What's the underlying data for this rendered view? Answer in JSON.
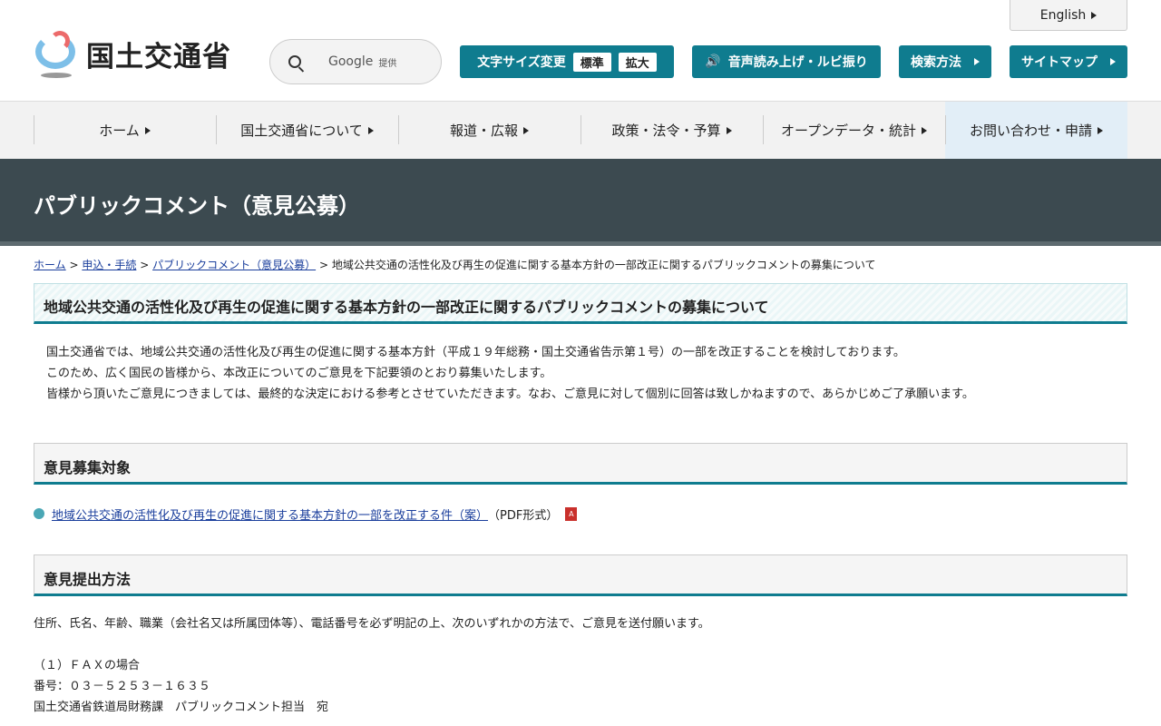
{
  "header": {
    "logo_text": "国土交通省",
    "search_brand": "Google",
    "search_suffix": "提供",
    "english": "English",
    "font_size_label": "文字サイズ変更",
    "font_standard": "標準",
    "font_large": "拡大",
    "speech": "音声読み上げ・ルビ振り",
    "search_method": "検索方法",
    "sitemap": "サイトマップ"
  },
  "nav": [
    {
      "label": "ホーム"
    },
    {
      "label": "国土交通省について"
    },
    {
      "label": "報道・広報"
    },
    {
      "label": "政策・法令・予算"
    },
    {
      "label": "オープンデータ・統計"
    },
    {
      "label": "お問い合わせ・申請"
    }
  ],
  "banner": "パブリックコメント（意見公募）",
  "breadcrumb": {
    "items": [
      "ホーム",
      "申込・手続",
      "パブリックコメント（意見公募）"
    ],
    "sep": ">",
    "current": "地域公共交通の活性化及び再生の促進に関する基本方針の一部改正に関するパブリックコメントの募集について"
  },
  "title": "地域公共交通の活性化及び再生の促進に関する基本方針の一部改正に関するパブリックコメントの募集について",
  "intro": [
    "国土交通省では、地域公共交通の活性化及び再生の促進に関する基本方針（平成１９年総務・国土交通省告示第１号）の一部を改正することを検討しております。",
    "このため、広く国民の皆様から、本改正についてのご意見を下記要領のとおり募集いたします。",
    "皆様から頂いたご意見につきましては、最終的な決定における参考とさせていただきます。なお、ご意見に対して個別に回答は致しかねますので、あらかじめご了承願います。"
  ],
  "section1": {
    "heading": "意見募集対象",
    "link": "地域公共交通の活性化及び再生の促進に関する基本方針の一部を改正する件（案）",
    "format": "（PDF形式）"
  },
  "section2": {
    "heading": "意見提出方法",
    "lines": [
      "住所、氏名、年齢、職業（会社名又は所属団体等）、電話番号を必ず明記の上、次のいずれかの方法で、ご意見を送付願います。",
      "",
      "（１）ＦＡＸの場合",
      "番号：０３－５２５３－１６３５",
      "国土交通省鉄道局財務課　パブリックコメント担当　宛"
    ]
  }
}
